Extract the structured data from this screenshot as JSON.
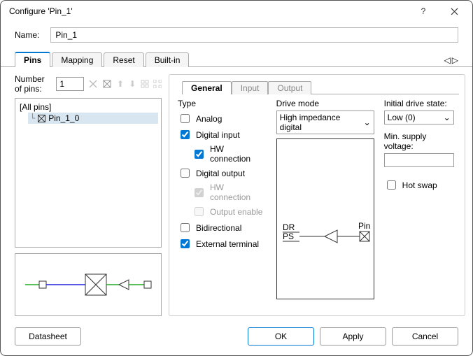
{
  "window": {
    "title": "Configure 'Pin_1'"
  },
  "name_field": {
    "label": "Name:",
    "value": "Pin_1"
  },
  "tabs": [
    "Pins",
    "Mapping",
    "Reset",
    "Built-in"
  ],
  "num_pins": {
    "label": "Number of pins:",
    "value": "1"
  },
  "tree": {
    "root": "[All pins]",
    "item": "Pin_1_0"
  },
  "subtabs": [
    "General",
    "Input",
    "Output"
  ],
  "type": {
    "header": "Type",
    "analog": "Analog",
    "digital_input": "Digital input",
    "hw_conn1": "HW connection",
    "digital_output": "Digital output",
    "hw_conn2": "HW connection",
    "output_enable": "Output enable",
    "bidirectional": "Bidirectional",
    "external_terminal": "External terminal"
  },
  "drive_mode": {
    "header": "Drive mode",
    "value": "High impedance digital"
  },
  "diagram": {
    "dr": "DR",
    "ps": "PS",
    "pin": "Pin"
  },
  "initial_drive": {
    "header": "Initial drive state:",
    "value": "Low (0)"
  },
  "min_supply": {
    "header": "Min. supply voltage:",
    "value": ""
  },
  "hot_swap": "Hot swap",
  "buttons": {
    "datasheet": "Datasheet",
    "ok": "OK",
    "apply": "Apply",
    "cancel": "Cancel"
  }
}
